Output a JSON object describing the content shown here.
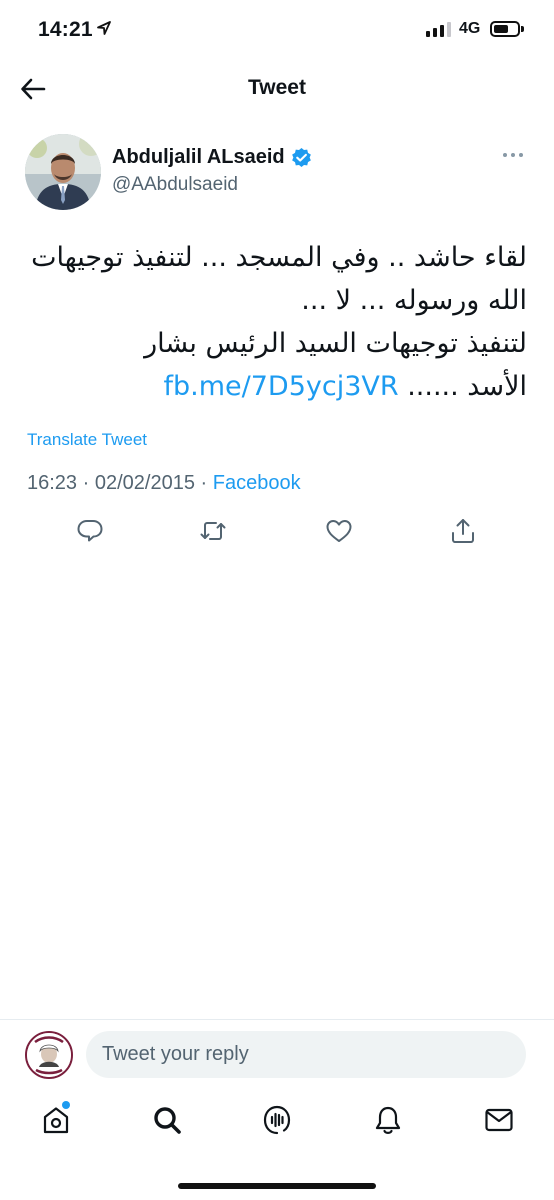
{
  "status_bar": {
    "time": "14:21",
    "network": "4G",
    "location_icon": "location-arrow-icon",
    "battery_level": 0.55
  },
  "header": {
    "title": "Tweet",
    "back_icon": "arrow-left-icon"
  },
  "tweet": {
    "author_name": "Abduljalil ALsaeid",
    "handle": "@AAbdulsaeid",
    "verified_icon": "verified-badge-icon",
    "text_lines": [
      "لقاء حاشد .. وفي المسجد ... لتنفيذ توجيهات",
      "الله ورسوله ... لا ...",
      "لتنفيذ توجيهات السيد الرئيس بشار",
      "الأسد ......"
    ],
    "link": "fb.me/7D5ycj3VR",
    "translate_label": "Translate Tweet",
    "time": "16:23",
    "date": "02/02/2015",
    "separator": "·",
    "source": "Facebook"
  },
  "actions": [
    {
      "name": "reply-button",
      "icon": "speech-bubble-icon"
    },
    {
      "name": "retweet-button",
      "icon": "retweet-icon"
    },
    {
      "name": "like-button",
      "icon": "heart-icon"
    },
    {
      "name": "share-button",
      "icon": "share-icon"
    }
  ],
  "reply": {
    "placeholder": "Tweet your reply"
  },
  "tabbar": {
    "items": [
      "home-icon",
      "search-icon",
      "spaces-icon",
      "bell-icon",
      "mail-icon"
    ],
    "home_has_dot": true
  },
  "colors": {
    "accent": "#1d9bf0",
    "text": "#0f1419",
    "secondary": "#536471",
    "input_bg": "#eff3f4"
  }
}
